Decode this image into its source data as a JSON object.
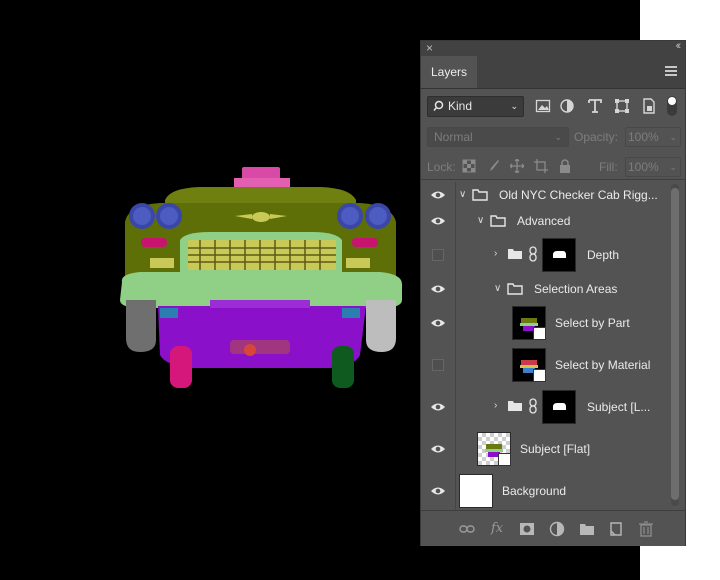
{
  "panel": {
    "tab_label": "Layers",
    "filter": {
      "kind_label": "Kind",
      "search_icon": "search-icon"
    },
    "blend_mode": "Normal",
    "opacity_label": "Opacity:",
    "opacity_value": "100%",
    "lock_label": "Lock:",
    "fill_label": "Fill:",
    "fill_value": "100%"
  },
  "layers": [
    {
      "name": "Old NYC Checker Cab Rigg...",
      "type": "group",
      "visible": true,
      "expanded": true
    },
    {
      "name": "Advanced",
      "type": "group",
      "visible": true,
      "expanded": true
    },
    {
      "name": "Depth",
      "type": "group-masked",
      "visible": false,
      "expanded": false
    },
    {
      "name": "Selection Areas",
      "type": "group",
      "visible": true,
      "expanded": true
    },
    {
      "name": "Select by Part",
      "type": "smart-object",
      "visible": true
    },
    {
      "name": "Select by Material",
      "type": "smart-object",
      "visible": false
    },
    {
      "name": "Subject [L...",
      "type": "group-masked",
      "visible": true,
      "expanded": false
    },
    {
      "name": "Subject [Flat]",
      "type": "smart-object",
      "visible": true
    },
    {
      "name": "Background",
      "type": "background",
      "visible": true
    }
  ],
  "colors": {
    "panel_bg": "#535353",
    "canvas_bg": "#000000",
    "car_body": "#6a7a10",
    "bumper": "#8fcf86",
    "underbody": "#8a11c9",
    "headlight": "#4d5cc0",
    "grille": "#c9c957",
    "roof_light": "#d94aa6"
  }
}
